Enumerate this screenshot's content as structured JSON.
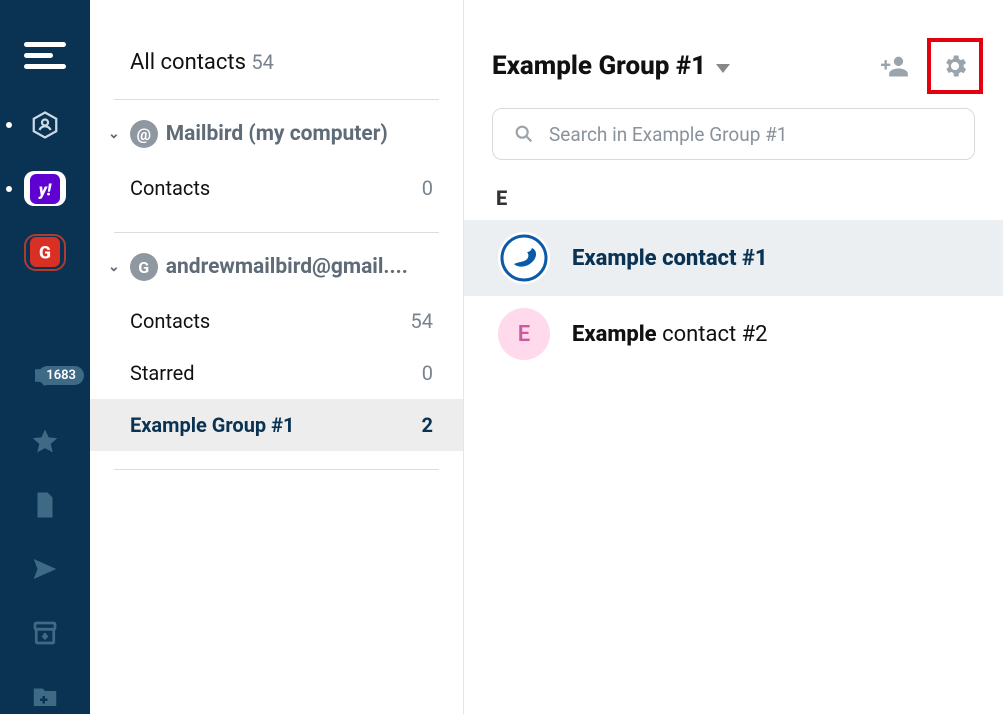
{
  "rail": {
    "badge_count": "1683"
  },
  "sidebar": {
    "all_contacts_label": "All contacts",
    "all_contacts_count": "54",
    "accounts": [
      {
        "label": "Mailbird (my computer)",
        "avatar_glyph": "@",
        "items": [
          {
            "label": "Contacts",
            "count": "0"
          }
        ]
      },
      {
        "label": "andrewmailbird@gmail....",
        "avatar_glyph": "G",
        "items": [
          {
            "label": "Contacts",
            "count": "54"
          },
          {
            "label": "Starred",
            "count": "0"
          },
          {
            "label": "Example Group #1",
            "count": "2",
            "selected": true
          }
        ]
      }
    ]
  },
  "main": {
    "group_title": "Example Group #1",
    "search_placeholder": "Search in Example Group #1",
    "section_letter": "E",
    "contacts": [
      {
        "bold": "Example contact #1",
        "rest": "",
        "selected": true,
        "avatar_type": "mailbird"
      },
      {
        "bold": "Example",
        "rest": " contact #2",
        "selected": false,
        "avatar_type": "letter",
        "avatar_letter": "E"
      }
    ]
  }
}
